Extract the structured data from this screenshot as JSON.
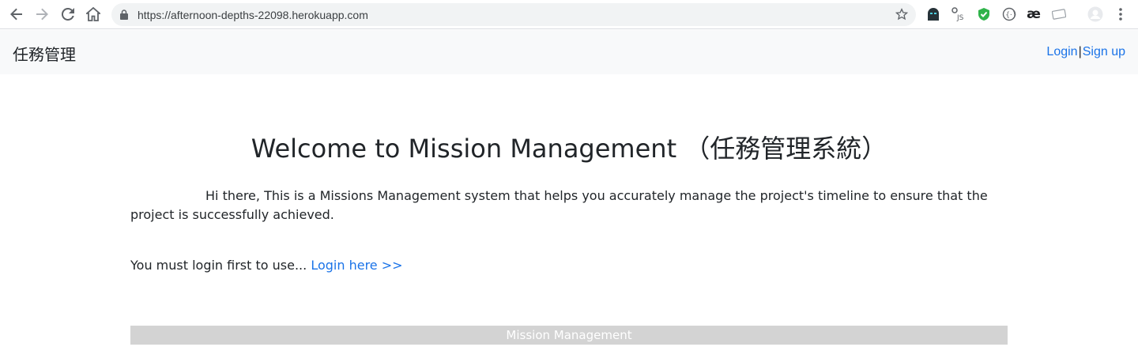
{
  "browser": {
    "url": "https://afternoon-depths-22098.herokuapp.com",
    "icons": {
      "back": "arrow-left-icon",
      "forward": "arrow-right-icon",
      "reload": "reload-icon",
      "home": "home-icon",
      "lock": "lock-icon",
      "star": "star-icon",
      "menu": "kebab-menu-icon"
    }
  },
  "navbar": {
    "brand": "任務管理",
    "login": "Login",
    "separator": "|",
    "signup": "Sign up"
  },
  "main": {
    "title": "Welcome to Mission Management （任務管理系統）",
    "intro": "Hi there, This is a Missions Management system that helps you accurately manage the project's timeline to ensure that the project is successfully achieved.",
    "login_prompt": "You must login first to use...",
    "login_link": "Login here >>"
  },
  "footer": {
    "text": "Mission Management"
  },
  "colors": {
    "link": "#1a73e8",
    "navbar_bg": "#f8f9fa",
    "footer_bg": "#d3d3d3"
  }
}
